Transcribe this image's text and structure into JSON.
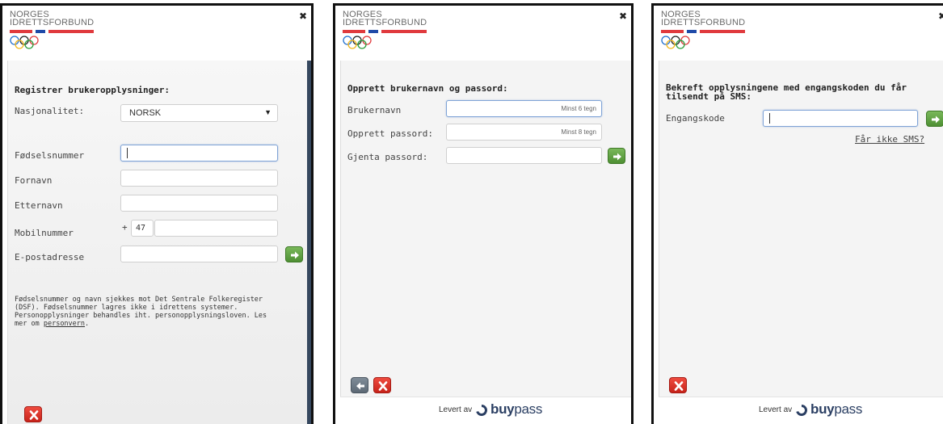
{
  "brand": {
    "line1": "NORGES",
    "line2": "IDRETTSFORBUND",
    "colors": {
      "red": "#e03a3e",
      "blue": "#1f4aa8"
    }
  },
  "close_icon": "close-icon",
  "panel1": {
    "title": "Registrer brukeropplysninger:",
    "fields": {
      "nationality_label": "Nasjonalitet:",
      "nationality_value": "NORSK",
      "fnr_label": "Fødselsnummer",
      "firstname_label": "Fornavn",
      "lastname_label": "Etternavn",
      "mobile_label": "Mobilnummer",
      "mobile_prefix": "+",
      "country_code": "47",
      "email_label": "E-postadresse"
    },
    "note": "Fødselsnummer og navn sjekkes mot Det Sentrale Folkeregister (DSF). Fødselsnummer lagres ikke i idrettens systemer. Personopplysninger behandles iht. personopplysningsloven. Les mer om",
    "note_link": "personvern",
    "note_end": "."
  },
  "panel2": {
    "title": "Opprett brukernavn og passord:",
    "username_label": "Brukernavn",
    "username_placeholder": "Minst 6 tegn",
    "password_label": "Opprett passord:",
    "password_placeholder": "Minst 8 tegn",
    "repeat_label": "Gjenta passord:"
  },
  "panel3": {
    "title": "Bekreft opplysningene med engangskoden du får tilsendt på SMS:",
    "code_label": "Engangskode",
    "no_sms_link": "Får ikke SMS?"
  },
  "footer": {
    "delivered_by": "Levert av",
    "brand_buy": "buy",
    "brand_pass": "pass"
  }
}
